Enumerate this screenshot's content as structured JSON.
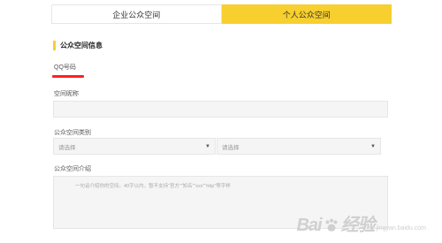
{
  "tabs": [
    {
      "label": "企业公众空间",
      "active": false
    },
    {
      "label": "个人公众空间",
      "active": true
    }
  ],
  "section": {
    "title": "公众空间信息"
  },
  "fields": {
    "qq_label": "QQ号码",
    "space_name_label": "空间昵称",
    "category_label": "公众空间类别",
    "category_select_1": "请选择",
    "category_select_2": "请选择",
    "intro_label": "公众空间介绍",
    "intro_placeholder": "一句话介绍你的空间。40字以内，暂不支持“官方”“知名”“xxx”“http”等字样"
  },
  "watermark": {
    "brand_left": "Bai",
    "brand_right": "经验",
    "sub": "jingyan.baidu.com"
  },
  "colors": {
    "accent": "#f7cf2e",
    "red_mark": "#ff2020"
  }
}
